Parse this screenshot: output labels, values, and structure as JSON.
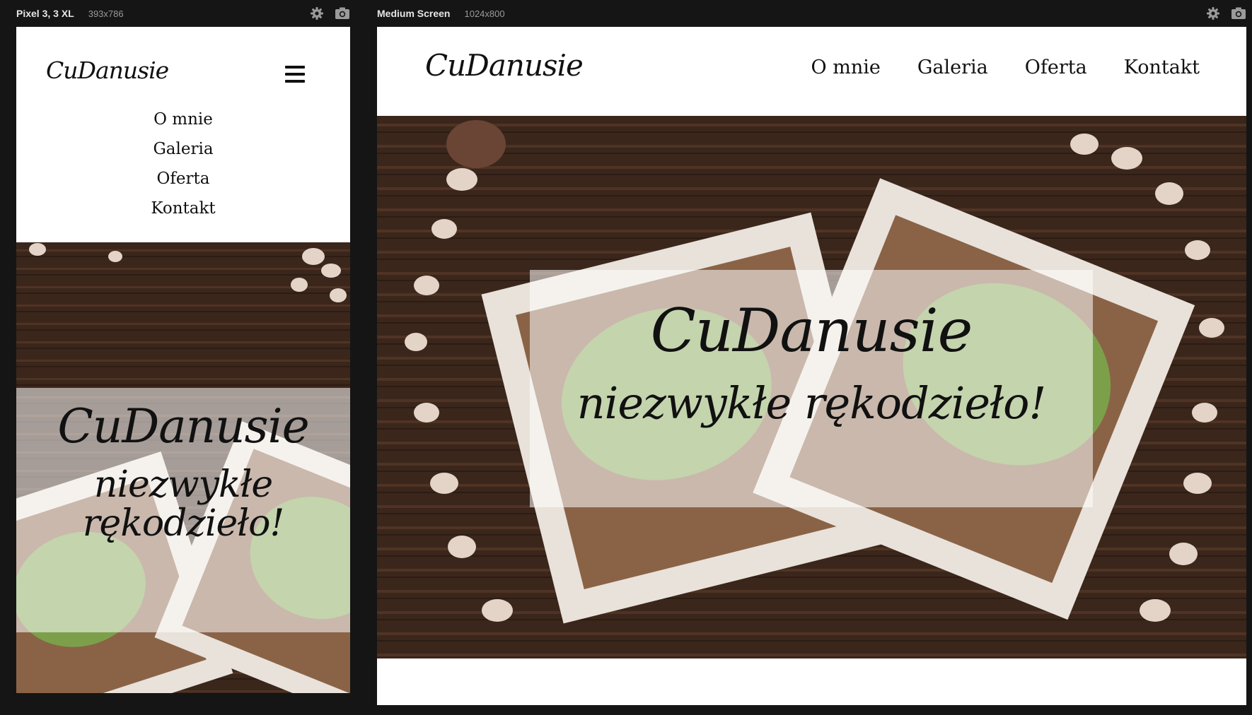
{
  "mobile": {
    "device_name": "Pixel 3, 3 XL",
    "device_size": "393x786",
    "logo": "CuDanusie",
    "nav": [
      "O mnie",
      "Galeria",
      "Oferta",
      "Kontakt"
    ],
    "hero_title": "CuDanusie",
    "hero_subtitle": "niezwykłe rękodzieło!"
  },
  "desktop": {
    "device_name": "Medium Screen",
    "device_size": "1024x800",
    "logo": "CuDanusie",
    "nav": [
      "O mnie",
      "Galeria",
      "Oferta",
      "Kontakt"
    ],
    "hero_title": "CuDanusie",
    "hero_subtitle": "niezwykłe rękodzieło!"
  },
  "icons": {
    "settings": "gear-icon",
    "screenshot": "camera-icon",
    "menu": "hamburger-menu-icon"
  },
  "colors": {
    "chrome_bg": "#151515",
    "wood_dark": "#3b261b",
    "wood_mid": "#5a3a28",
    "frame_white": "#e8e2da",
    "burlap": "#8a6347",
    "moss": "#7aa64a"
  }
}
